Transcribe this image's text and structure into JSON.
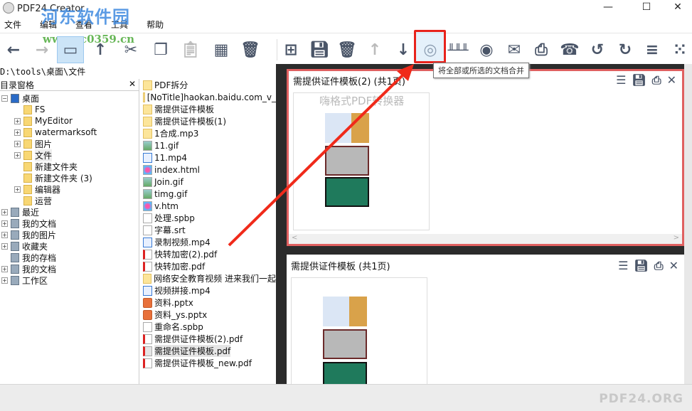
{
  "window": {
    "title": "PDF24 Creator",
    "minimize": "—",
    "maximize": "☐",
    "close": "✕"
  },
  "watermark": {
    "site_name": "河东软件园",
    "url": "www.pc0359.cn"
  },
  "menu": [
    "文件",
    "编辑",
    "查看",
    "工具",
    "帮助"
  ],
  "toolbar": {
    "tooltip": "将全部或所选的文档合并",
    "accent": "#e8231c"
  },
  "path": "D:\\tools\\桌面\\文件",
  "left_pane": {
    "title": "目录窗格",
    "close": "✕",
    "tree": [
      {
        "label": "桌面",
        "level": 0,
        "expander": "−"
      },
      {
        "label": "FS",
        "level": 1,
        "expander": ""
      },
      {
        "label": "MyEditor",
        "level": 1,
        "expander": "+"
      },
      {
        "label": "watermarksoft",
        "level": 1,
        "expander": "+"
      },
      {
        "label": "图片",
        "level": 1,
        "expander": "+"
      },
      {
        "label": "文件",
        "level": 1,
        "expander": "+"
      },
      {
        "label": "新建文件夹",
        "level": 1,
        "expander": ""
      },
      {
        "label": "新建文件夹 (3)",
        "level": 1,
        "expander": ""
      },
      {
        "label": "编辑器",
        "level": 1,
        "expander": "+"
      },
      {
        "label": "运营",
        "level": 1,
        "expander": ""
      },
      {
        "label": "最近",
        "level": 0,
        "expander": "+"
      },
      {
        "label": "我的文档",
        "level": 0,
        "expander": "+"
      },
      {
        "label": "我的图片",
        "level": 0,
        "expander": "+"
      },
      {
        "label": "收藏夹",
        "level": 0,
        "expander": "+"
      },
      {
        "label": "我的存档",
        "level": 0,
        "expander": ""
      },
      {
        "label": "我的文档",
        "level": 0,
        "expander": "+"
      },
      {
        "label": "工作区",
        "level": 0,
        "expander": "+"
      }
    ]
  },
  "files": [
    {
      "name": "PDF拆分",
      "type": "fold"
    },
    {
      "name": "[NoTitle]haokan.baidu.com_v_",
      "type": "fold"
    },
    {
      "name": "需提供证件模板",
      "type": "fold"
    },
    {
      "name": "需提供证件模板(1)",
      "type": "fold"
    },
    {
      "name": "1合成.mp3",
      "type": "fold"
    },
    {
      "name": "11.gif",
      "type": "img"
    },
    {
      "name": "11.mp4",
      "type": "vid"
    },
    {
      "name": "index.html",
      "type": "web"
    },
    {
      "name": "Join.gif",
      "type": "img"
    },
    {
      "name": "timg.gif",
      "type": "img"
    },
    {
      "name": "v.htm",
      "type": "web"
    },
    {
      "name": "处理.spbp",
      "type": "doc"
    },
    {
      "name": "字幕.srt",
      "type": "doc"
    },
    {
      "name": "录制视频.mp4",
      "type": "vid"
    },
    {
      "name": "快转加密(2).pdf",
      "type": "pdf"
    },
    {
      "name": "快转加密.pdf",
      "type": "pdf"
    },
    {
      "name": "网络安全教育视频 进来我们一起",
      "type": "fold"
    },
    {
      "name": "视频拼接.mp4",
      "type": "vid"
    },
    {
      "name": "资料.pptx",
      "type": "ppt"
    },
    {
      "name": "资料_ys.pptx",
      "type": "ppt"
    },
    {
      "name": "重命名.spbp",
      "type": "doc"
    },
    {
      "name": "需提供证件模板(2).pdf",
      "type": "pdf"
    },
    {
      "name": "需提供证件模板.pdf",
      "type": "pdf",
      "selected": true
    },
    {
      "name": "需提供证件模板_new.pdf",
      "type": "pdf"
    }
  ],
  "documents": [
    {
      "title": "需提供证件模板(2) (共1页)",
      "page_watermark": "嗨格式PDF转换器"
    },
    {
      "title": "需提供证件模板 (共1页)"
    }
  ],
  "status": {
    "brand": "PDF24.ORG"
  }
}
